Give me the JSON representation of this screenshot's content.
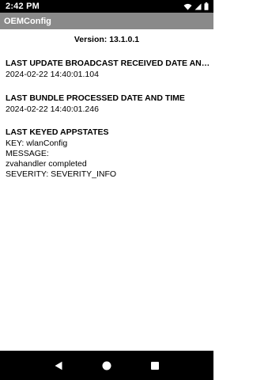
{
  "status_bar": {
    "time": "2:42 PM",
    "icons": [
      "wifi-icon",
      "signal-icon",
      "battery-icon"
    ]
  },
  "app_bar": {
    "title": "OEMConfig"
  },
  "main": {
    "version": "Version: 13.1.0.1",
    "sections": [
      {
        "heading": "LAST UPDATE BROADCAST RECEIVED DATE AND TIME",
        "value": "2024-02-22 14:40:01.104"
      },
      {
        "heading": "LAST BUNDLE PROCESSED DATE AND TIME",
        "value": "2024-02-22 14:40:01.246"
      },
      {
        "heading": "LAST KEYED APPSTATES",
        "lines": [
          "KEY: wlanConfig",
          "MESSAGE:",
          "zvahandler completed",
          "SEVERITY: SEVERITY_INFO"
        ]
      }
    ]
  },
  "nav_bar": {
    "buttons": [
      "back-icon",
      "home-icon",
      "recents-icon"
    ]
  },
  "colors": {
    "status_bar": "#000000",
    "app_bar": "#8a8a8a",
    "nav_bar": "#000000",
    "content_bg": "#ffffff"
  }
}
